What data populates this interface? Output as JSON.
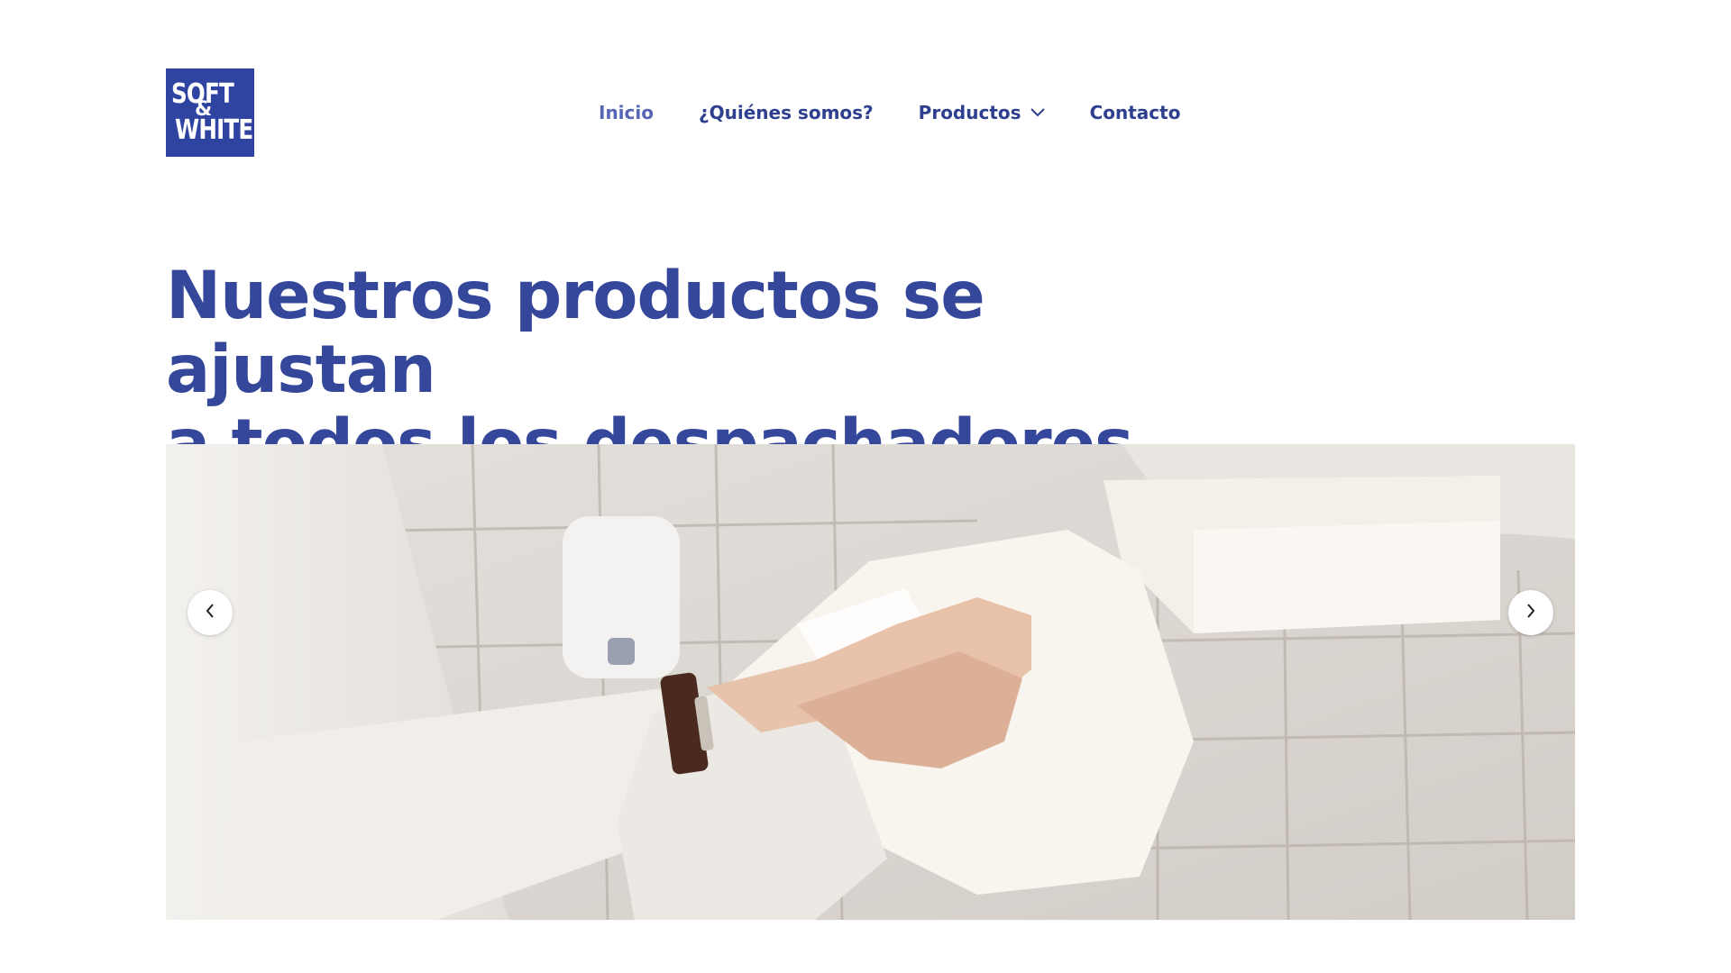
{
  "brand": {
    "logo_line1": "SOFT",
    "logo_amp": "&",
    "logo_line2": "WHITE",
    "color": "#2f44a1"
  },
  "nav": {
    "items": [
      {
        "label": "Inicio",
        "active": true
      },
      {
        "label": "¿Quiénes somos?",
        "active": false
      },
      {
        "label": "Productos",
        "active": false,
        "has_dropdown": true,
        "icon": "chevron-down-icon"
      },
      {
        "label": "Contacto",
        "active": false
      }
    ]
  },
  "hero": {
    "title_line1": "Nuestros productos se ajustan",
    "title_line2": "a todos los despachadores",
    "title_color": "#34479a"
  },
  "slider": {
    "image_alt": "Hands drying with paper towel from wall dispenser",
    "prev_icon": "chevron-left-icon",
    "next_icon": "chevron-right-icon"
  }
}
